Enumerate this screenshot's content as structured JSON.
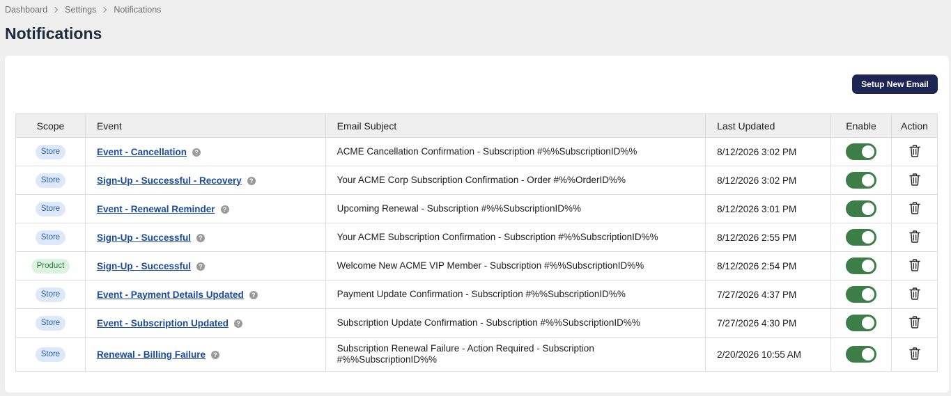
{
  "breadcrumb": [
    "Dashboard",
    "Settings",
    "Notifications"
  ],
  "page_title": "Notifications",
  "setup_button": "Setup New Email",
  "table": {
    "headers": {
      "scope": "Scope",
      "event": "Event",
      "subject": "Email Subject",
      "updated": "Last Updated",
      "enable": "Enable",
      "action": "Action"
    },
    "rows": [
      {
        "scope": "Store",
        "scope_type": "store",
        "event": "Event - Cancellation",
        "subject": "ACME Cancellation Confirmation - Subscription #%%SubscriptionID%%",
        "updated": "8/12/2026 3:02 PM",
        "enabled": true
      },
      {
        "scope": "Store",
        "scope_type": "store",
        "event": "Sign-Up - Successful - Recovery",
        "subject": "Your ACME Corp Subscription Confirmation - Order #%%OrderID%%",
        "updated": "8/12/2026 3:02 PM",
        "enabled": true
      },
      {
        "scope": "Store",
        "scope_type": "store",
        "event": "Event - Renewal Reminder",
        "subject": "Upcoming Renewal - Subscription #%%SubscriptionID%%",
        "updated": "8/12/2026 3:01 PM",
        "enabled": true
      },
      {
        "scope": "Store",
        "scope_type": "store",
        "event": "Sign-Up - Successful",
        "subject": "Your ACME Subscription Confirmation - Subscription #%%SubscriptionID%%",
        "updated": "8/12/2026 2:55 PM",
        "enabled": true
      },
      {
        "scope": "Product",
        "scope_type": "product",
        "event": "Sign-Up - Successful",
        "subject": "Welcome New ACME VIP Member - Subscription #%%SubscriptionID%%",
        "updated": "8/12/2026 2:54 PM",
        "enabled": true
      },
      {
        "scope": "Store",
        "scope_type": "store",
        "event": "Event - Payment Details Updated",
        "subject": "Payment Update Confirmation - Subscription #%%SubscriptionID%%",
        "updated": "7/27/2026 4:37 PM",
        "enabled": true
      },
      {
        "scope": "Store",
        "scope_type": "store",
        "event": "Event - Subscription Updated",
        "subject": "Subscription Update Confirmation - Subscription #%%SubscriptionID%%",
        "updated": "7/27/2026 4:30 PM",
        "enabled": true
      },
      {
        "scope": "Store",
        "scope_type": "store",
        "event": "Renewal - Billing Failure",
        "subject": "Subscription Renewal Failure - Action Required - Subscription #%%SubscriptionID%%",
        "updated": "2/20/2026 10:55 AM",
        "enabled": true
      }
    ]
  },
  "icons": {
    "breadcrumb_separator": "chevron-right-icon",
    "help": "question-circle-icon",
    "delete": "trash-icon"
  },
  "colors": {
    "primary_button": "#1d2554",
    "toggle_on": "#3d7d48",
    "link": "#1a4aa0",
    "store_badge_bg": "#dde9fb",
    "product_badge_bg": "#dcf3df"
  }
}
